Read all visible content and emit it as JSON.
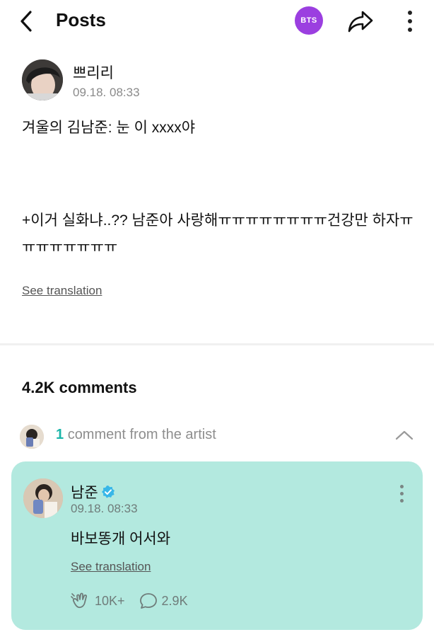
{
  "header": {
    "title": "Posts",
    "badge_label": "BTS",
    "back_icon": "chevron-left-icon",
    "share_icon": "share-icon",
    "more_icon": "more-vertical-icon"
  },
  "post": {
    "author_name": "쁘리리",
    "timestamp": "09.18. 08:33",
    "line1": "겨울의 김남준: 눈 이 xxxx야",
    "line2": "+이거 실화냐..?? 남준아 사랑해ㅠㅠㅠㅠㅠㅠㅠㅠ건강만 하자ㅠㅠㅠㅠㅠㅠㅠㅠ",
    "see_translation": "See translation"
  },
  "comments": {
    "count_label": "4.2K comments",
    "artist_count": "1",
    "artist_label": "comment from the artist"
  },
  "artist_comment": {
    "name": "남준",
    "verified": true,
    "timestamp": "09.18. 08:33",
    "text": "바보똥개 어서와",
    "see_translation": "See translation",
    "likes": "10K+",
    "replies": "2.9K"
  },
  "colors": {
    "accent_teal": "#1bb5a9",
    "card_bg": "#b3e9df",
    "badge_purple": "#9b3fe0"
  }
}
